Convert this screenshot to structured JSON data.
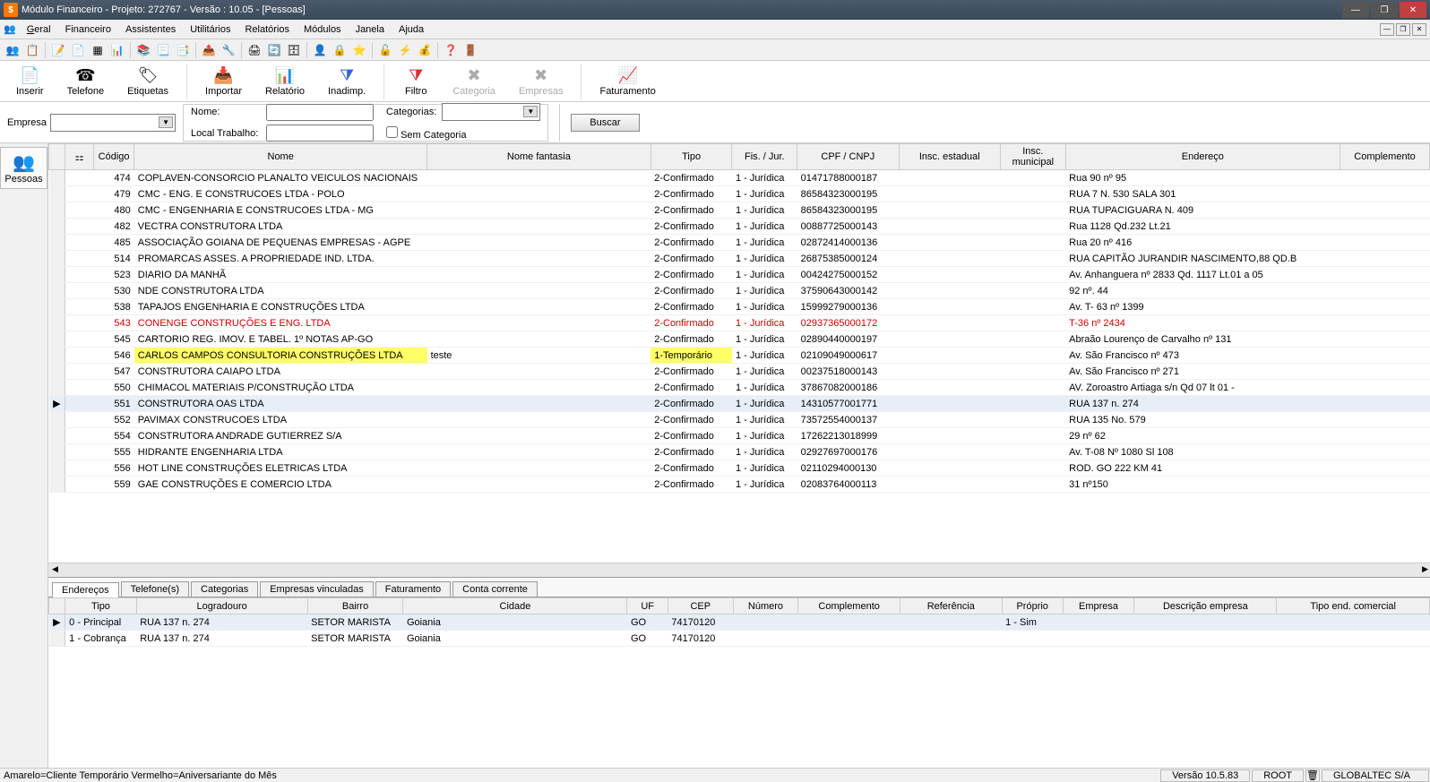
{
  "window": {
    "title": "Módulo Financeiro - Projeto: 272767 - Versão : 10.05 - [Pessoas]"
  },
  "menus": {
    "geral": "Geral",
    "financeiro": "Financeiro",
    "assistentes": "Assistentes",
    "utilitarios": "Utilitários",
    "relatorios": "Relatórios",
    "modulos": "Módulos",
    "janela": "Janela",
    "ajuda": "Ajuda"
  },
  "toolbar": {
    "inserir": "Inserir",
    "telefone": "Telefone",
    "etiquetas": "Etiquetas",
    "importar": "Importar",
    "relatorio": "Relatório",
    "inadimp": "Inadimp.",
    "filtro": "Filtro",
    "categoria": "Categoria",
    "empresas": "Empresas",
    "faturamento": "Faturamento"
  },
  "filters": {
    "empresa_label": "Empresa",
    "nome_label": "Nome:",
    "local_label": "Local Trabalho:",
    "categorias_label": "Categorias:",
    "sem_cat_label": "Sem Categoria",
    "buscar": "Buscar"
  },
  "sidetab": {
    "pessoas": "Pessoas"
  },
  "grid": {
    "headers": {
      "codigo": "Código",
      "nome": "Nome",
      "fantasia": "Nome fantasia",
      "tipo": "Tipo",
      "fisjur": "Fis. / Jur.",
      "cpf": "CPF / CNPJ",
      "ie": "Insc. estadual",
      "im": "Insc. municipal",
      "endereco": "Endereço",
      "complemento": "Complemento"
    },
    "rows": [
      {
        "cod": "474",
        "nome": "COPLAVEN-CONSORCIO PLANALTO VEICULOS NACIONAIS",
        "fant": "",
        "tipo": "2-Confirmado",
        "fj": "1 - Jurídica",
        "cpf": "01471788000187",
        "end": "Rua 90 nº 95"
      },
      {
        "cod": "479",
        "nome": "CMC - ENG. E CONSTRUCOES LTDA - POLO",
        "fant": "",
        "tipo": "2-Confirmado",
        "fj": "1 - Jurídica",
        "cpf": "86584323000195",
        "end": "RUA 7 N. 530 SALA 301"
      },
      {
        "cod": "480",
        "nome": "CMC - ENGENHARIA E CONSTRUCOES LTDA - MG",
        "fant": "",
        "tipo": "2-Confirmado",
        "fj": "1 - Jurídica",
        "cpf": "86584323000195",
        "end": "RUA TUPACIGUARA N. 409"
      },
      {
        "cod": "482",
        "nome": "VECTRA CONSTRUTORA LTDA",
        "fant": "",
        "tipo": "2-Confirmado",
        "fj": "1 - Jurídica",
        "cpf": "00887725000143",
        "end": "Rua 1128 Qd.232 Lt.21"
      },
      {
        "cod": "485",
        "nome": "ASSOCIAÇÃO GOIANA DE PEQUENAS EMPRESAS - AGPE",
        "fant": "",
        "tipo": "2-Confirmado",
        "fj": "1 - Jurídica",
        "cpf": "02872414000136",
        "end": "Rua 20 nº 416"
      },
      {
        "cod": "514",
        "nome": "PROMARCAS ASSES. A PROPRIEDADE IND. LTDA.",
        "fant": "",
        "tipo": "2-Confirmado",
        "fj": "1 - Jurídica",
        "cpf": "26875385000124",
        "end": "RUA CAPITÃO JURANDIR NASCIMENTO,88 QD.B"
      },
      {
        "cod": "523",
        "nome": "DIARIO DA MANHÃ",
        "fant": "",
        "tipo": "2-Confirmado",
        "fj": "1 - Jurídica",
        "cpf": "00424275000152",
        "end": "Av. Anhanguera nº 2833 Qd. 1117 Lt.01 a 05"
      },
      {
        "cod": "530",
        "nome": "NDE CONSTRUTORA LTDA",
        "fant": "",
        "tipo": "2-Confirmado",
        "fj": "1 - Jurídica",
        "cpf": "37590643000142",
        "end": "92 nº. 44"
      },
      {
        "cod": "538",
        "nome": "TAPAJOS ENGENHARIA E CONSTRUÇÕES LTDA",
        "fant": "",
        "tipo": "2-Confirmado",
        "fj": "1 - Jurídica",
        "cpf": "15999279000136",
        "end": "Av. T- 63 nº 1399"
      },
      {
        "cod": "543",
        "nome": "CONENGE CONSTRUÇÕES E ENG. LTDA",
        "fant": "",
        "tipo": "2-Confirmado",
        "fj": "1 - Jurídica",
        "cpf": "02937365000172",
        "end": "T-36 nº 2434",
        "red": true
      },
      {
        "cod": "545",
        "nome": "CARTORIO REG. IMOV. E TABEL. 1º NOTAS AP-GO",
        "fant": "",
        "tipo": "2-Confirmado",
        "fj": "1 - Jurídica",
        "cpf": "02890440000197",
        "end": "Abraão Lourenço de Carvalho nº 131"
      },
      {
        "cod": "546",
        "nome": "CARLOS CAMPOS CONSULTORIA CONSTRUÇÕES LTDA",
        "fant": "teste",
        "tipo": "1-Temporário",
        "fj": "1 - Jurídica",
        "cpf": "02109049000617",
        "end": "Av. São Francisco nº 473",
        "yellow": true
      },
      {
        "cod": "547",
        "nome": "CONSTRUTORA CAIAPO LTDA",
        "fant": "",
        "tipo": "2-Confirmado",
        "fj": "1 - Jurídica",
        "cpf": "00237518000143",
        "end": "Av. São Francisco nº 271"
      },
      {
        "cod": "550",
        "nome": "CHIMACOL MATERIAIS P/CONSTRUÇÃO LTDA",
        "fant": "",
        "tipo": "2-Confirmado",
        "fj": "1 - Jurídica",
        "cpf": "37867082000186",
        "end": "AV. Zoroastro Artiaga s/n  Qd 07 lt 01 -"
      },
      {
        "cod": "551",
        "nome": "CONSTRUTORA OAS LTDA",
        "fant": "",
        "tipo": "2-Confirmado",
        "fj": "1 - Jurídica",
        "cpf": "14310577001771",
        "end": "RUA 137 n. 274",
        "selected": true
      },
      {
        "cod": "552",
        "nome": "PAVIMAX CONSTRUCOES LTDA",
        "fant": "",
        "tipo": "2-Confirmado",
        "fj": "1 - Jurídica",
        "cpf": "73572554000137",
        "end": "RUA 135 No. 579"
      },
      {
        "cod": "554",
        "nome": "CONSTRUTORA ANDRADE GUTIERREZ S/A",
        "fant": "",
        "tipo": "2-Confirmado",
        "fj": "1 - Jurídica",
        "cpf": "17262213018999",
        "end": "29 nº 62"
      },
      {
        "cod": "555",
        "nome": "HIDRANTE ENGENHARIA LTDA",
        "fant": "",
        "tipo": "2-Confirmado",
        "fj": "1 - Jurídica",
        "cpf": "02927697000176",
        "end": "Av. T-08 Nº 1080 Sl 108"
      },
      {
        "cod": "556",
        "nome": "HOT LINE CONSTRUÇÕES ELETRICAS LTDA",
        "fant": "",
        "tipo": "2-Confirmado",
        "fj": "1 - Jurídica",
        "cpf": "02110294000130",
        "end": "ROD. GO 222 KM 41"
      },
      {
        "cod": "559",
        "nome": "GAE CONSTRUÇÕES E COMERCIO LTDA",
        "fant": "",
        "tipo": "2-Confirmado",
        "fj": "1 - Jurídica",
        "cpf": "02083764000113",
        "end": "31 nº150"
      }
    ]
  },
  "detail_tabs": {
    "enderecos": "Endereços",
    "telefones": "Telefone(s)",
    "categorias": "Categorias",
    "empresas": "Empresas vinculadas",
    "faturamento": "Faturamento",
    "conta": "Conta corrente"
  },
  "detail_grid": {
    "headers": {
      "tipo": "Tipo",
      "logradouro": "Logradouro",
      "bairro": "Bairro",
      "cidade": "Cidade",
      "uf": "UF",
      "cep": "CEP",
      "numero": "Número",
      "complemento": "Complemento",
      "referencia": "Referência",
      "proprio": "Próprio",
      "empresa": "Empresa",
      "desc": "Descrição empresa",
      "tec": "Tipo end. comercial"
    },
    "rows": [
      {
        "tipo": "0 - Principal",
        "log": "RUA 137 n. 274",
        "bairro": "SETOR MARISTA",
        "cid": "Goiania",
        "uf": "GO",
        "cep": "74170120",
        "prop": "1 - Sim",
        "selected": true
      },
      {
        "tipo": "1 - Cobrança",
        "log": "RUA 137 n. 274",
        "bairro": "SETOR MARISTA",
        "cid": "Goiania",
        "uf": "GO",
        "cep": "74170120",
        "prop": ""
      }
    ]
  },
  "status": {
    "legend": "Amarelo=Cliente Temporário  Vermelho=Aniversariante do Mês",
    "versao": "Versão 10.5.83",
    "user": "ROOT",
    "empresa": "GLOBALTEC S/A"
  }
}
